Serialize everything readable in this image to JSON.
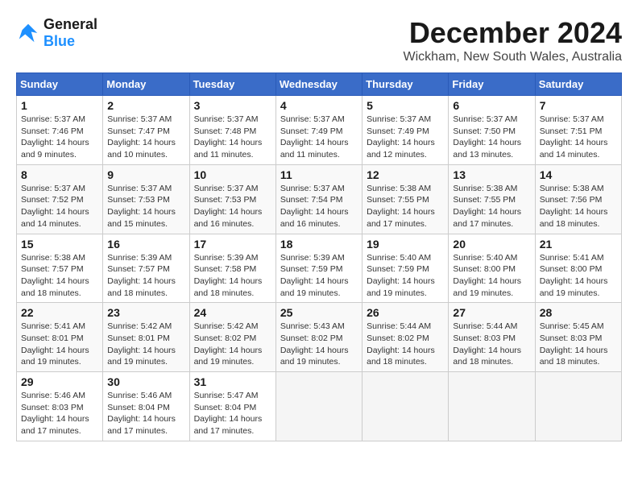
{
  "logo": {
    "line1": "General",
    "line2": "Blue"
  },
  "title": "December 2024",
  "location": "Wickham, New South Wales, Australia",
  "weekdays": [
    "Sunday",
    "Monday",
    "Tuesday",
    "Wednesday",
    "Thursday",
    "Friday",
    "Saturday"
  ],
  "weeks": [
    [
      {
        "day": "1",
        "info": "Sunrise: 5:37 AM\nSunset: 7:46 PM\nDaylight: 14 hours\nand 9 minutes."
      },
      {
        "day": "2",
        "info": "Sunrise: 5:37 AM\nSunset: 7:47 PM\nDaylight: 14 hours\nand 10 minutes."
      },
      {
        "day": "3",
        "info": "Sunrise: 5:37 AM\nSunset: 7:48 PM\nDaylight: 14 hours\nand 11 minutes."
      },
      {
        "day": "4",
        "info": "Sunrise: 5:37 AM\nSunset: 7:49 PM\nDaylight: 14 hours\nand 11 minutes."
      },
      {
        "day": "5",
        "info": "Sunrise: 5:37 AM\nSunset: 7:49 PM\nDaylight: 14 hours\nand 12 minutes."
      },
      {
        "day": "6",
        "info": "Sunrise: 5:37 AM\nSunset: 7:50 PM\nDaylight: 14 hours\nand 13 minutes."
      },
      {
        "day": "7",
        "info": "Sunrise: 5:37 AM\nSunset: 7:51 PM\nDaylight: 14 hours\nand 14 minutes."
      }
    ],
    [
      {
        "day": "8",
        "info": "Sunrise: 5:37 AM\nSunset: 7:52 PM\nDaylight: 14 hours\nand 14 minutes."
      },
      {
        "day": "9",
        "info": "Sunrise: 5:37 AM\nSunset: 7:53 PM\nDaylight: 14 hours\nand 15 minutes."
      },
      {
        "day": "10",
        "info": "Sunrise: 5:37 AM\nSunset: 7:53 PM\nDaylight: 14 hours\nand 16 minutes."
      },
      {
        "day": "11",
        "info": "Sunrise: 5:37 AM\nSunset: 7:54 PM\nDaylight: 14 hours\nand 16 minutes."
      },
      {
        "day": "12",
        "info": "Sunrise: 5:38 AM\nSunset: 7:55 PM\nDaylight: 14 hours\nand 17 minutes."
      },
      {
        "day": "13",
        "info": "Sunrise: 5:38 AM\nSunset: 7:55 PM\nDaylight: 14 hours\nand 17 minutes."
      },
      {
        "day": "14",
        "info": "Sunrise: 5:38 AM\nSunset: 7:56 PM\nDaylight: 14 hours\nand 18 minutes."
      }
    ],
    [
      {
        "day": "15",
        "info": "Sunrise: 5:38 AM\nSunset: 7:57 PM\nDaylight: 14 hours\nand 18 minutes."
      },
      {
        "day": "16",
        "info": "Sunrise: 5:39 AM\nSunset: 7:57 PM\nDaylight: 14 hours\nand 18 minutes."
      },
      {
        "day": "17",
        "info": "Sunrise: 5:39 AM\nSunset: 7:58 PM\nDaylight: 14 hours\nand 18 minutes."
      },
      {
        "day": "18",
        "info": "Sunrise: 5:39 AM\nSunset: 7:59 PM\nDaylight: 14 hours\nand 19 minutes."
      },
      {
        "day": "19",
        "info": "Sunrise: 5:40 AM\nSunset: 7:59 PM\nDaylight: 14 hours\nand 19 minutes."
      },
      {
        "day": "20",
        "info": "Sunrise: 5:40 AM\nSunset: 8:00 PM\nDaylight: 14 hours\nand 19 minutes."
      },
      {
        "day": "21",
        "info": "Sunrise: 5:41 AM\nSunset: 8:00 PM\nDaylight: 14 hours\nand 19 minutes."
      }
    ],
    [
      {
        "day": "22",
        "info": "Sunrise: 5:41 AM\nSunset: 8:01 PM\nDaylight: 14 hours\nand 19 minutes."
      },
      {
        "day": "23",
        "info": "Sunrise: 5:42 AM\nSunset: 8:01 PM\nDaylight: 14 hours\nand 19 minutes."
      },
      {
        "day": "24",
        "info": "Sunrise: 5:42 AM\nSunset: 8:02 PM\nDaylight: 14 hours\nand 19 minutes."
      },
      {
        "day": "25",
        "info": "Sunrise: 5:43 AM\nSunset: 8:02 PM\nDaylight: 14 hours\nand 19 minutes."
      },
      {
        "day": "26",
        "info": "Sunrise: 5:44 AM\nSunset: 8:02 PM\nDaylight: 14 hours\nand 18 minutes."
      },
      {
        "day": "27",
        "info": "Sunrise: 5:44 AM\nSunset: 8:03 PM\nDaylight: 14 hours\nand 18 minutes."
      },
      {
        "day": "28",
        "info": "Sunrise: 5:45 AM\nSunset: 8:03 PM\nDaylight: 14 hours\nand 18 minutes."
      }
    ],
    [
      {
        "day": "29",
        "info": "Sunrise: 5:46 AM\nSunset: 8:03 PM\nDaylight: 14 hours\nand 17 minutes."
      },
      {
        "day": "30",
        "info": "Sunrise: 5:46 AM\nSunset: 8:04 PM\nDaylight: 14 hours\nand 17 minutes."
      },
      {
        "day": "31",
        "info": "Sunrise: 5:47 AM\nSunset: 8:04 PM\nDaylight: 14 hours\nand 17 minutes."
      },
      {
        "day": "",
        "info": ""
      },
      {
        "day": "",
        "info": ""
      },
      {
        "day": "",
        "info": ""
      },
      {
        "day": "",
        "info": ""
      }
    ]
  ]
}
